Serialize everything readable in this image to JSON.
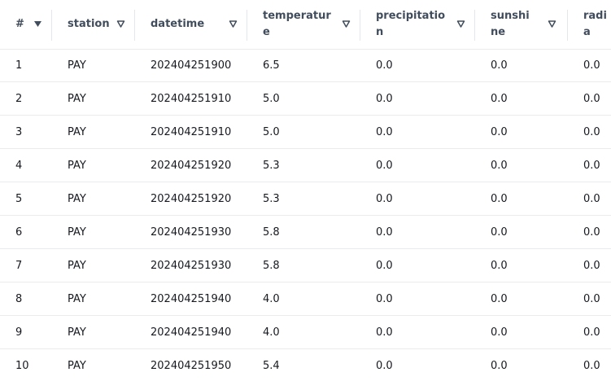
{
  "table": {
    "columns": [
      {
        "label": "#",
        "sort_icon": "filled-triangle-down-icon"
      },
      {
        "label": "station",
        "sort_icon": "triangle-down-icon"
      },
      {
        "label": "datetime",
        "sort_icon": "triangle-down-icon"
      },
      {
        "label": "temperature",
        "sort_icon": "triangle-down-icon"
      },
      {
        "label": "precipitation",
        "sort_icon": "triangle-down-icon"
      },
      {
        "label": "sunshine",
        "sort_icon": "triangle-down-icon"
      },
      {
        "label": "radia",
        "sort_icon": ""
      }
    ],
    "rows": [
      [
        "1",
        "PAY",
        "202404251900",
        "6.5",
        "0.0",
        "0.0",
        "0.0"
      ],
      [
        "2",
        "PAY",
        "202404251910",
        "5.0",
        "0.0",
        "0.0",
        "0.0"
      ],
      [
        "3",
        "PAY",
        "202404251910",
        "5.0",
        "0.0",
        "0.0",
        "0.0"
      ],
      [
        "4",
        "PAY",
        "202404251920",
        "5.3",
        "0.0",
        "0.0",
        "0.0"
      ],
      [
        "5",
        "PAY",
        "202404251920",
        "5.3",
        "0.0",
        "0.0",
        "0.0"
      ],
      [
        "6",
        "PAY",
        "202404251930",
        "5.8",
        "0.0",
        "0.0",
        "0.0"
      ],
      [
        "7",
        "PAY",
        "202404251930",
        "5.8",
        "0.0",
        "0.0",
        "0.0"
      ],
      [
        "8",
        "PAY",
        "202404251940",
        "4.0",
        "0.0",
        "0.0",
        "0.0"
      ],
      [
        "9",
        "PAY",
        "202404251940",
        "4.0",
        "0.0",
        "0.0",
        "0.0"
      ],
      [
        "10",
        "PAY",
        "202404251950",
        "5.4",
        "0.0",
        "0.0",
        "0.0"
      ]
    ]
  },
  "colors": {
    "header_text": "#414d5c",
    "cell_text": "#16191f",
    "row_border": "#e9ebed",
    "icon": "#414d5c"
  }
}
